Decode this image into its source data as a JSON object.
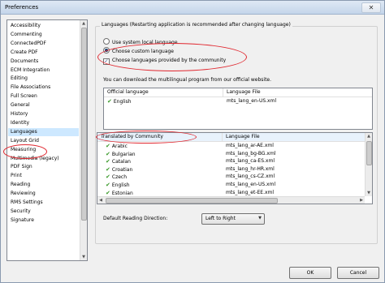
{
  "window": {
    "title": "Preferences",
    "close_glyph": "✕"
  },
  "sidebar": {
    "items": [
      "Accessibility",
      "Commenting",
      "ConnectedPDF",
      "Create PDF",
      "Documents",
      "ECM Integration",
      "Editing",
      "File Associations",
      "Full Screen",
      "General",
      "History",
      "Identity",
      "Languages",
      "Layout Grid",
      "Measuring",
      "Multimedia (legacy)",
      "PDF Sign",
      "Print",
      "Reading",
      "Reviewing",
      "RMS Settings",
      "Security",
      "Signature"
    ],
    "selected": "Languages"
  },
  "languages": {
    "group_label": "Languages (Restarting application is recommended after changing language)",
    "radio_system": "Use system local language",
    "radio_custom": "Choose custom language",
    "checkbox_community": "Choose languages provided by the community",
    "info": "You can download the multilingual program from our official website.",
    "official": {
      "col_language": "Official language",
      "col_file": "Language File",
      "rows": [
        {
          "language": "English",
          "file": "mts_lang_en-US.xml"
        }
      ]
    },
    "community": {
      "col_language": "Translated by Community",
      "col_file": "Language File",
      "rows": [
        {
          "language": "Arabic",
          "file": "mts_lang_ar-AE.xml"
        },
        {
          "language": "Bulgarian",
          "file": "mts_lang_bg-BG.xml"
        },
        {
          "language": "Catalan",
          "file": "mts_lang_ca-ES.xml"
        },
        {
          "language": "Croatian",
          "file": "mts_lang_hr-HR.xml"
        },
        {
          "language": "Czech",
          "file": "mts_lang_cs-CZ.xml"
        },
        {
          "language": "English",
          "file": "mts_lang_en-US.xml"
        },
        {
          "language": "Estonian",
          "file": "mts_lang_et-EE.xml"
        }
      ]
    },
    "reading_direction_label": "Default Reading Direction:",
    "reading_direction_value": "Left to Right"
  },
  "buttons": {
    "ok": "OK",
    "cancel": "Cancel"
  },
  "colors": {
    "highlight_ellipse": "#e0262e",
    "check_green": "#3a9a2a",
    "selected_row": "#cde8ff"
  }
}
